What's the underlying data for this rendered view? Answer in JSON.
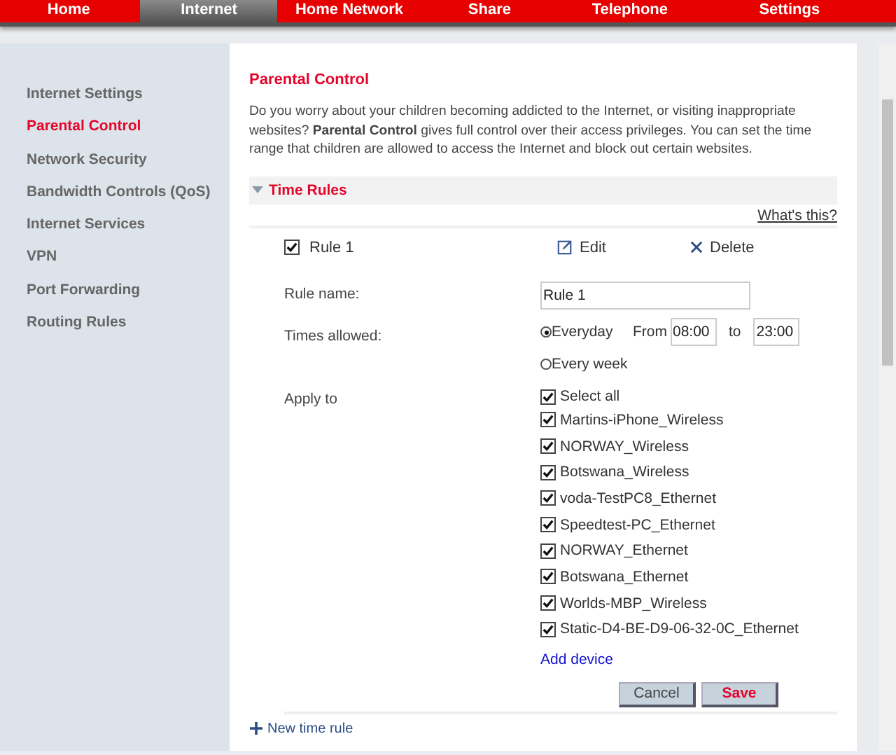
{
  "nav_tabs": [
    {
      "label": "Home",
      "selected": false
    },
    {
      "label": "Internet",
      "selected": true
    },
    {
      "label": "Home Network",
      "selected": false
    },
    {
      "label": "Share",
      "selected": false
    },
    {
      "label": "Telephone",
      "selected": false
    },
    {
      "label": "Settings",
      "selected": false
    }
  ],
  "sidebar": {
    "items": [
      {
        "label": "Internet Settings",
        "selected": false
      },
      {
        "label": "Parental Control",
        "selected": true
      },
      {
        "label": "Network Security",
        "selected": false
      },
      {
        "label": "Bandwidth Controls (QoS)",
        "selected": false
      },
      {
        "label": "Internet Services",
        "selected": false
      },
      {
        "label": "VPN",
        "selected": false
      },
      {
        "label": "Port Forwarding",
        "selected": false
      },
      {
        "label": "Routing Rules",
        "selected": false
      }
    ]
  },
  "page": {
    "title": "Parental Control",
    "intro": "Do you worry about your children becoming addicted to the Internet, or visiting inappropriate websites? **Parental Control** gives full control over their access privileges. You can set the time range that children are allowed to access the Internet and block out certain websites."
  },
  "time_rules": {
    "title": "Time Rules",
    "expanded": true,
    "help_link": "What's this?",
    "rule": {
      "label": "Rule 1",
      "checked": true,
      "edit": "Edit",
      "delete": "Delete"
    },
    "form": {
      "rule_name_label": "Rule name:",
      "rule_name_value": "Rule 1",
      "times_label": "Times allowed:",
      "options": [
        {
          "label": "Everyday",
          "selected": true
        },
        {
          "label": "Every week",
          "selected": false
        }
      ],
      "from_label": "From",
      "from_value": "08:00",
      "to_label": "to",
      "to_value": "23:00",
      "apply_label": "Apply to",
      "select_all": {
        "label": "Select all",
        "checked": true
      },
      "devices": [
        {
          "label": "Martins-iPhone_Wireless",
          "checked": true
        },
        {
          "label": "NORWAY_Wireless",
          "checked": true
        },
        {
          "label": "Botswana_Wireless",
          "checked": true
        },
        {
          "label": "voda-TestPC8_Ethernet",
          "checked": true
        },
        {
          "label": "Speedtest-PC_Ethernet",
          "checked": true
        },
        {
          "label": "NORWAY_Ethernet",
          "checked": true
        },
        {
          "label": "Botswana_Ethernet",
          "checked": true
        },
        {
          "label": "Worlds-MBP_Wireless",
          "checked": true
        },
        {
          "label": "Static-D4-BE-D9-06-32-0C_Ethernet",
          "checked": true
        }
      ],
      "add_device": "Add device"
    },
    "buttons": {
      "cancel": "Cancel",
      "save": "Save"
    },
    "new_rule": "New time rule"
  }
}
